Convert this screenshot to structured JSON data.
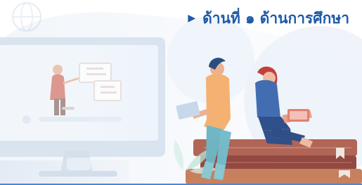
{
  "section": {
    "bullet_icon": "play-triangle-icon",
    "title": "ด้านที่ ๑ ด้านการศึกษา",
    "title_color": "#1f5aa6"
  },
  "illustration": {
    "description_icon_names": [
      "monitor-icon",
      "presenter-icon",
      "laptop-icon",
      "books-icon",
      "plant-icon"
    ]
  }
}
